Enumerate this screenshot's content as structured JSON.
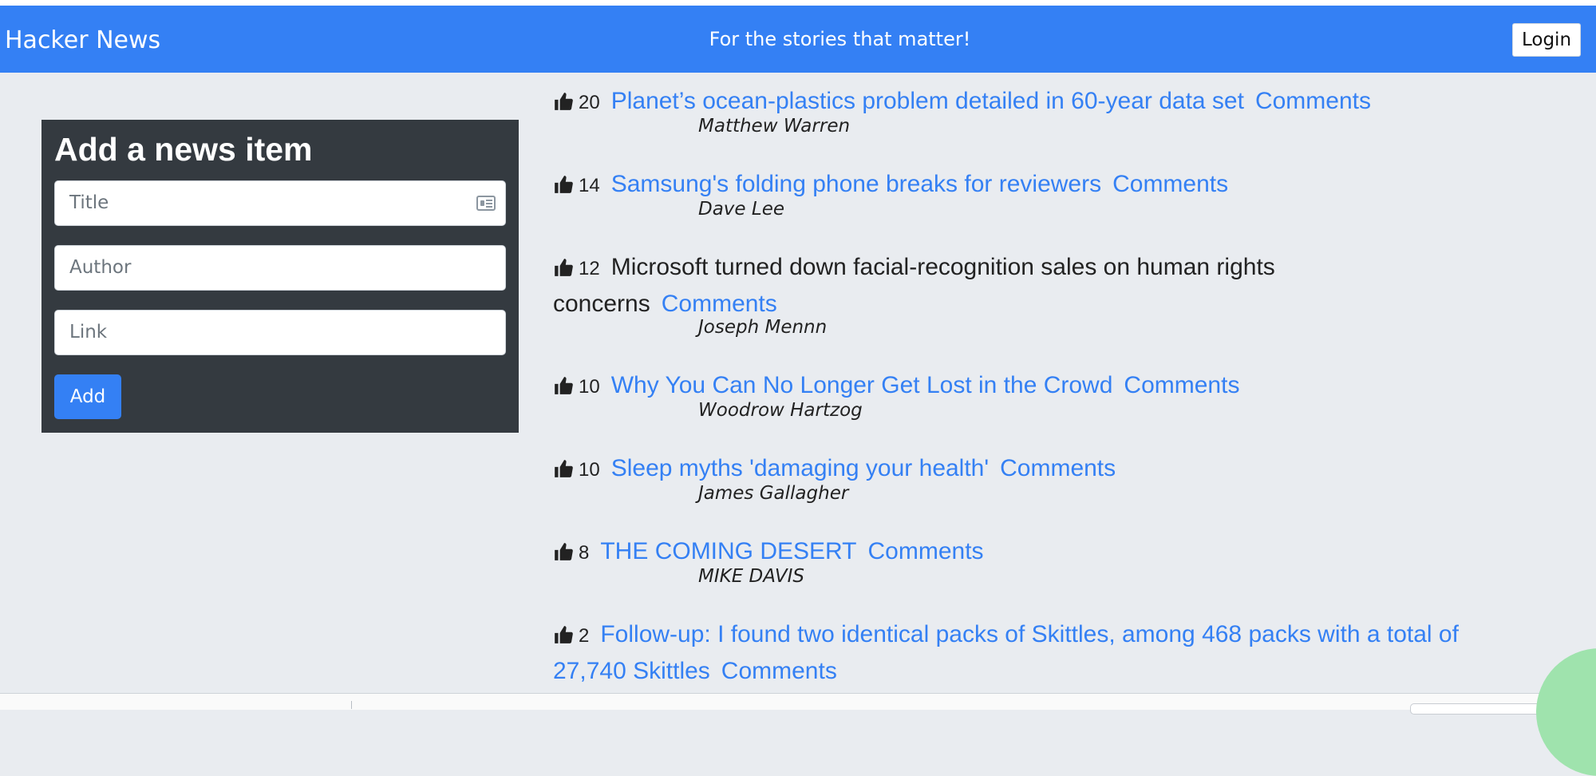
{
  "navbar": {
    "brand": "Hacker News",
    "tagline": "For the stories that matter!",
    "login_label": "Login"
  },
  "form": {
    "heading": "Add a news item",
    "title_placeholder": "Title",
    "author_placeholder": "Author",
    "link_placeholder": "Link",
    "add_label": "Add"
  },
  "news_items": [
    {
      "votes": "20",
      "title": "Planet’s ocean-plastics problem detailed in 60-year data set",
      "comments": "Comments",
      "author": "Matthew Warren",
      "linked": true
    },
    {
      "votes": "14",
      "title": "Samsung's folding phone breaks for reviewers",
      "comments": "Comments",
      "author": "Dave Lee",
      "linked": true
    },
    {
      "votes": "12",
      "title": "Microsoft turned down facial-recognition sales on human rights concerns",
      "comments": "Comments",
      "author": "Joseph Mennn",
      "linked": false
    },
    {
      "votes": "10",
      "title": "Why You Can No Longer Get Lost in the Crowd",
      "comments": "Comments",
      "author": "Woodrow Hartzog",
      "linked": true
    },
    {
      "votes": "10",
      "title": "Sleep myths 'damaging your health'",
      "comments": "Comments",
      "author": "James Gallagher",
      "linked": true
    },
    {
      "votes": "8",
      "title": "THE COMING DESERT",
      "comments": "Comments",
      "author": "MIKE DAVIS",
      "linked": true
    },
    {
      "votes": "2",
      "title": "Follow-up: I found two identical packs of Skittles, among 468 packs with a total of 27,740 Skittles",
      "comments": "Comments",
      "author": "",
      "linked": true
    }
  ],
  "colors": {
    "accent": "#3480f4",
    "panel": "#343a40",
    "background": "#e9ecf0"
  },
  "icons": {
    "vote": "thumbs-up-icon",
    "title_field": "id-card-icon"
  }
}
